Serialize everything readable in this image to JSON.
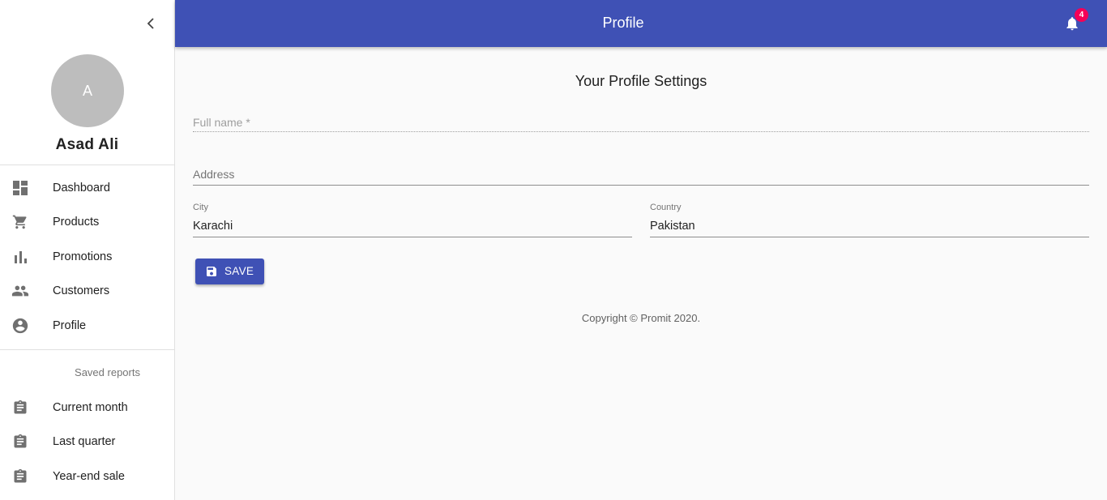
{
  "sidebar": {
    "collapse_icon": "chevron-left-icon",
    "avatar_initial": "A",
    "user_name": "Asad Ali",
    "nav_items": [
      {
        "label": "Dashboard",
        "icon": "dashboard-icon"
      },
      {
        "label": "Products",
        "icon": "cart-icon"
      },
      {
        "label": "Promotions",
        "icon": "bar-chart-icon"
      },
      {
        "label": "Customers",
        "icon": "people-icon"
      },
      {
        "label": "Profile",
        "icon": "account-circle-icon"
      }
    ],
    "saved_reports_header": "Saved reports",
    "reports": [
      {
        "label": "Current month",
        "icon": "assignment-icon"
      },
      {
        "label": "Last quarter",
        "icon": "assignment-icon"
      },
      {
        "label": "Year-end sale",
        "icon": "assignment-icon"
      }
    ]
  },
  "appbar": {
    "title": "Profile",
    "notification_icon": "bell-icon",
    "notification_count": "4",
    "color": "#3f51b5",
    "badge_color": "#f50057"
  },
  "main": {
    "heading": "Your Profile Settings",
    "fields": {
      "full_name": {
        "placeholder": "Full name *",
        "value": ""
      },
      "address": {
        "placeholder": "Address",
        "value": ""
      },
      "city": {
        "label": "City",
        "value": "Karachi"
      },
      "country": {
        "label": "Country",
        "value": "Pakistan"
      }
    },
    "save_button": {
      "label": "SAVE",
      "icon": "save-icon"
    },
    "copyright": "Copyright © Promit 2020."
  }
}
